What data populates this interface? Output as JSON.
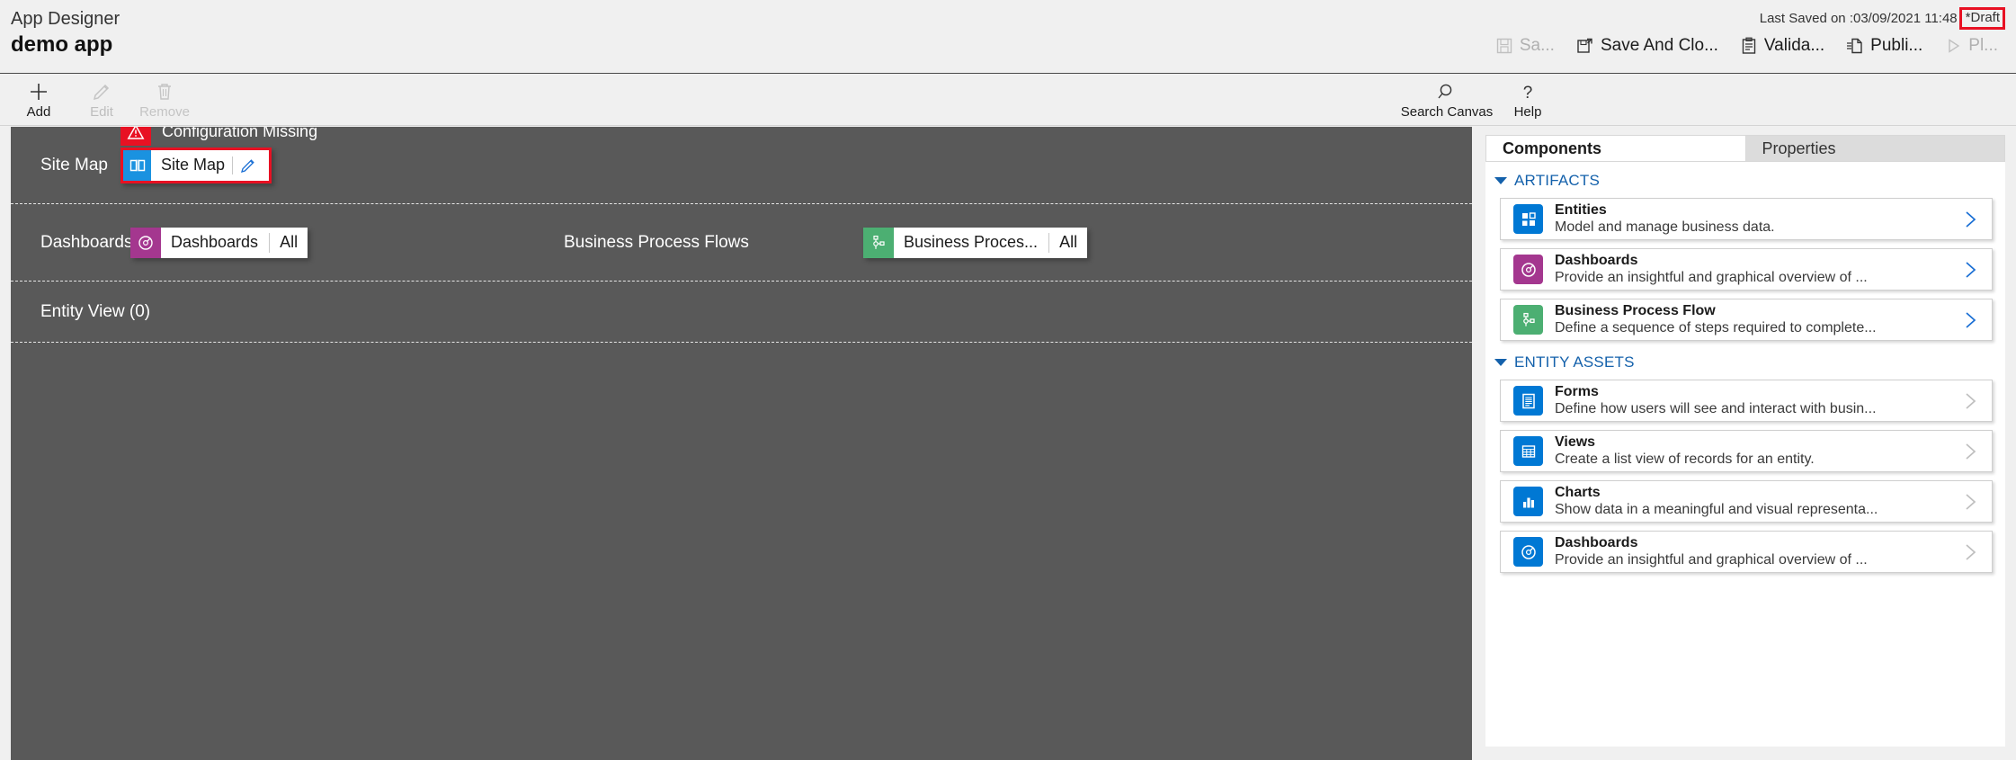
{
  "header": {
    "app_designer_label": "App Designer",
    "app_name": "demo app",
    "last_saved": "Last Saved on :03/09/2021 11:48",
    "draft_status": "*Draft",
    "draft_highlight_color": "#e81123",
    "commands": [
      {
        "name": "save",
        "label": "Sa...",
        "icon": "save-icon",
        "disabled": true
      },
      {
        "name": "save-and-close",
        "label": "Save And Clo...",
        "icon": "save-and-close-icon",
        "disabled": false
      },
      {
        "name": "validate",
        "label": "Valida...",
        "icon": "validate-icon",
        "disabled": false
      },
      {
        "name": "publish",
        "label": "Publi...",
        "icon": "publish-icon",
        "disabled": false
      },
      {
        "name": "play",
        "label": "Pl...",
        "icon": "play-icon",
        "disabled": true
      }
    ]
  },
  "toolbar": {
    "left": [
      {
        "name": "add",
        "label": "Add",
        "icon": "plus-icon",
        "disabled": false
      },
      {
        "name": "edit",
        "label": "Edit",
        "icon": "pencil-icon",
        "disabled": true
      },
      {
        "name": "remove",
        "label": "Remove",
        "icon": "trash-icon",
        "disabled": true
      }
    ],
    "right": [
      {
        "name": "search-canvas",
        "label": "Search Canvas",
        "icon": "search-icon",
        "disabled": false
      },
      {
        "name": "help",
        "label": "Help",
        "icon": "question-icon",
        "disabled": false
      }
    ]
  },
  "canvas": {
    "sitemap_row": {
      "label": "Site Map",
      "warning_text": "Configuration Missing",
      "warning_icon": "warning-triangle-icon",
      "warning_color": "#e81123",
      "tile": {
        "name": "Site Map",
        "icon": "sitemap-book-icon",
        "icon_color": "#1a92e0",
        "edit_icon": "pencil-icon",
        "selected": true
      }
    },
    "dashboards_row": {
      "label": "Dashboards",
      "tile": {
        "name": "Dashboards",
        "tail": "All",
        "icon": "dashboard-gauge-icon",
        "icon_color": "#a4378f"
      }
    },
    "bpf_row": {
      "label": "Business Process Flows",
      "tile": {
        "name": "Business Proces...",
        "tail": "All",
        "icon": "bpf-node-icon",
        "icon_color": "#4caf72"
      }
    },
    "entity_row": {
      "label": "Entity View (0)"
    }
  },
  "right_panel": {
    "tabs": [
      {
        "name": "components",
        "label": "Components",
        "active": true
      },
      {
        "name": "properties",
        "label": "Properties",
        "active": false
      }
    ],
    "groups": [
      {
        "name": "artifacts",
        "title": "ARTIFACTS",
        "expanded": true,
        "cards": [
          {
            "name": "entities",
            "title": "Entities",
            "desc": "Model and manage business data.",
            "icon": "entities-grid-icon",
            "icon_color": "#0078d4",
            "chevron_enabled": true
          },
          {
            "name": "dashboards",
            "title": "Dashboards",
            "desc": "Provide an insightful and graphical overview of ...",
            "icon": "dashboard-gauge-icon",
            "icon_color": "#a4378f",
            "chevron_enabled": true
          },
          {
            "name": "business-process-flow",
            "title": "Business Process Flow",
            "desc": "Define a sequence of steps required to complete...",
            "icon": "bpf-node-icon",
            "icon_color": "#4caf72",
            "chevron_enabled": true
          }
        ]
      },
      {
        "name": "entity-assets",
        "title": "ENTITY ASSETS",
        "expanded": true,
        "cards": [
          {
            "name": "forms",
            "title": "Forms",
            "desc": "Define how users will see and interact with busin...",
            "icon": "form-icon",
            "icon_color": "#0078d4",
            "chevron_enabled": false
          },
          {
            "name": "views",
            "title": "Views",
            "desc": "Create a list view of records for an entity.",
            "icon": "views-table-icon",
            "icon_color": "#0078d4",
            "chevron_enabled": false
          },
          {
            "name": "charts",
            "title": "Charts",
            "desc": "Show data in a meaningful and visual representa...",
            "icon": "charts-bar-icon",
            "icon_color": "#0078d4",
            "chevron_enabled": false
          },
          {
            "name": "dashboards-entity",
            "title": "Dashboards",
            "desc": "Provide an insightful and graphical overview of ...",
            "icon": "dashboard-gauge-icon",
            "icon_color": "#0078d4",
            "chevron_enabled": false
          }
        ]
      }
    ]
  }
}
